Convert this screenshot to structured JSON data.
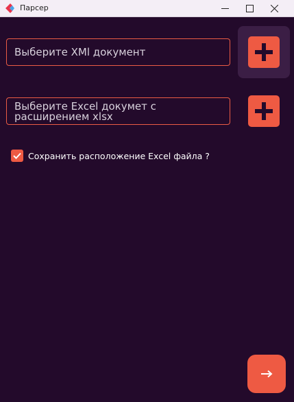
{
  "window": {
    "title": "Парсер",
    "icon": "app-logo-icon",
    "controls": [
      "minimize-icon",
      "maximize-icon",
      "close-icon"
    ]
  },
  "xml_field": {
    "placeholder": "Выберите XMl документ"
  },
  "excel_field": {
    "placeholder": "Выберите Excel докумет с расширением xlsx"
  },
  "add_xml_button": {
    "icon": "plus-icon"
  },
  "add_excel_button": {
    "icon": "plus-icon"
  },
  "save_location_checkbox": {
    "label": "Сохранить расположение Excel файла ?",
    "checked": true
  },
  "next_button": {
    "icon": "arrow-right-icon"
  },
  "colors": {
    "background": "#230a2b",
    "accent": "#ee5a43",
    "titlebar": "#f4eef6",
    "field_text": "#d8d1dc"
  }
}
